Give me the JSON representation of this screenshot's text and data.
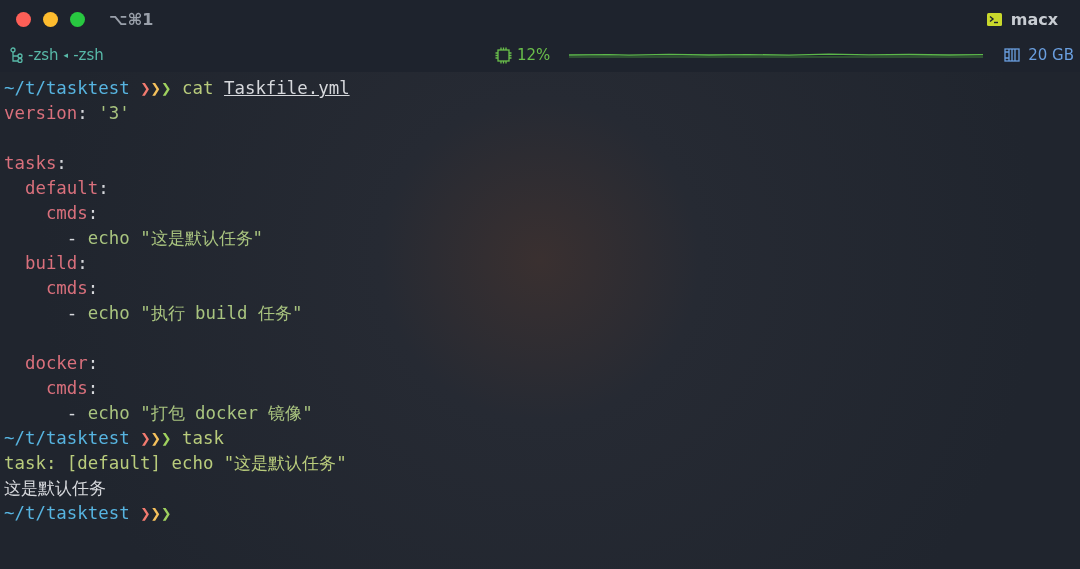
{
  "window": {
    "title": "⌥⌘1",
    "profile": "macx"
  },
  "tab_bar": {
    "session": "-zsh",
    "separator": "◂",
    "job": "-zsh",
    "cpu": "12%",
    "memory": "20 GB"
  },
  "terminal": [
    {
      "kind": "prompt",
      "path": "~/t/tasktest",
      "arrows": [
        {
          "glyph": "❯",
          "color": "#f27a6f"
        },
        {
          "glyph": "❯",
          "color": "#f5c15c"
        },
        {
          "glyph": "❯",
          "color": "#9fd15f"
        }
      ],
      "command": "cat",
      "argument": "Taskfile.yml"
    },
    {
      "kind": "yaml",
      "entries": [
        {
          "key": "version",
          "sep": ":",
          "value": "'3'"
        },
        {
          "key": "tasks",
          "sep": ":",
          "gap_before": true,
          "children": [
            {
              "key": "default",
              "sep": ":",
              "children": [
                {
                  "key": "cmds",
                  "sep": ":",
                  "children": [
                    {
                      "marker": "-",
                      "text": "echo \"这是默认任务\""
                    }
                  ]
                }
              ]
            },
            {
              "key": "build",
              "sep": ":",
              "children": [
                {
                  "key": "cmds",
                  "sep": ":",
                  "children": [
                    {
                      "marker": "-",
                      "text": "echo \"执行 build 任务\""
                    }
                  ]
                }
              ]
            },
            {
              "key": "docker",
              "sep": ":",
              "gap_before": true,
              "children": [
                {
                  "key": "cmds",
                  "sep": ":",
                  "children": [
                    {
                      "marker": "-",
                      "text": "echo \"打包 docker 镜像\""
                    }
                  ]
                }
              ]
            }
          ]
        }
      ]
    },
    {
      "kind": "prompt",
      "path": "~/t/tasktest",
      "arrows": [
        {
          "glyph": "❯",
          "color": "#f27a6f"
        },
        {
          "glyph": "❯",
          "color": "#f5c15c"
        },
        {
          "glyph": "❯",
          "color": "#9fd15f"
        }
      ],
      "command": "task"
    },
    {
      "kind": "log",
      "text": "task: [default] echo \"这是默认任务\""
    },
    {
      "kind": "output",
      "text": "这是默认任务"
    },
    {
      "kind": "prompt",
      "path": "~/t/tasktest",
      "arrows": [
        {
          "glyph": "❯",
          "color": "#f27a6f"
        },
        {
          "glyph": "❯",
          "color": "#f5c15c"
        },
        {
          "glyph": "❯",
          "color": "#9fd15f"
        }
      ]
    }
  ]
}
